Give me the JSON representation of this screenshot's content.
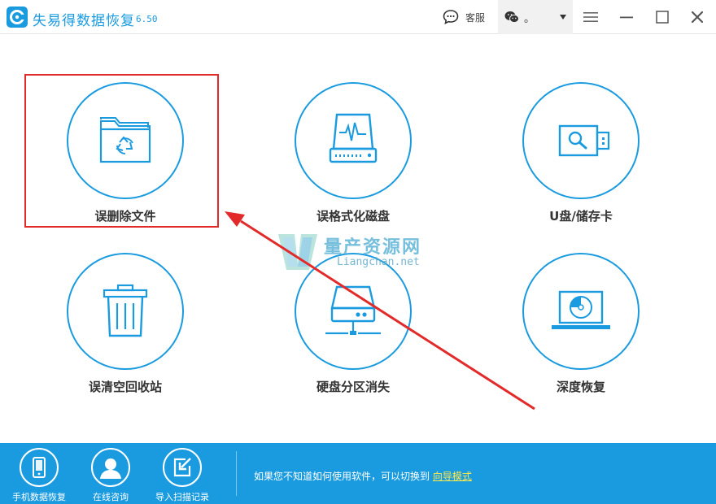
{
  "titlebar": {
    "app_name": "失易得数据恢复",
    "version": "6.50",
    "support_label": "客服",
    "wechat_name": "。",
    "icons": [
      "app-logo-icon",
      "chat-bubble-icon",
      "wechat-icon",
      "menu-icon",
      "minimize-icon",
      "maximize-icon",
      "close-icon"
    ]
  },
  "tiles": [
    {
      "label": "误删除文件",
      "icon": "folder-recycle-icon"
    },
    {
      "label": "误格式化磁盘",
      "icon": "hard-disk-pulse-icon"
    },
    {
      "label": "U盘/储存卡",
      "icon": "usb-drive-icon"
    },
    {
      "label": "误清空回收站",
      "icon": "trash-bin-icon"
    },
    {
      "label": "硬盘分区消失",
      "icon": "network-drive-icon"
    },
    {
      "label": "深度恢复",
      "icon": "laptop-disk-icon"
    }
  ],
  "annotation": {
    "highlight_color": "#e32a2a",
    "target": "误删除文件"
  },
  "watermark": {
    "title": "量产资源网",
    "subtitle": "Liangchan.net"
  },
  "bottombar": {
    "items": [
      {
        "label": "手机数据恢复",
        "icon": "phone-icon"
      },
      {
        "label": "在线咨询",
        "icon": "person-icon"
      },
      {
        "label": "导入扫描记录",
        "icon": "import-icon"
      }
    ],
    "hint_text": "如果您不知道如何使用软件，可以切换到",
    "hint_link": "向导模式"
  },
  "colors": {
    "accent": "#1a9be0",
    "link": "#ffe94a",
    "annotation": "#e32a2a"
  }
}
